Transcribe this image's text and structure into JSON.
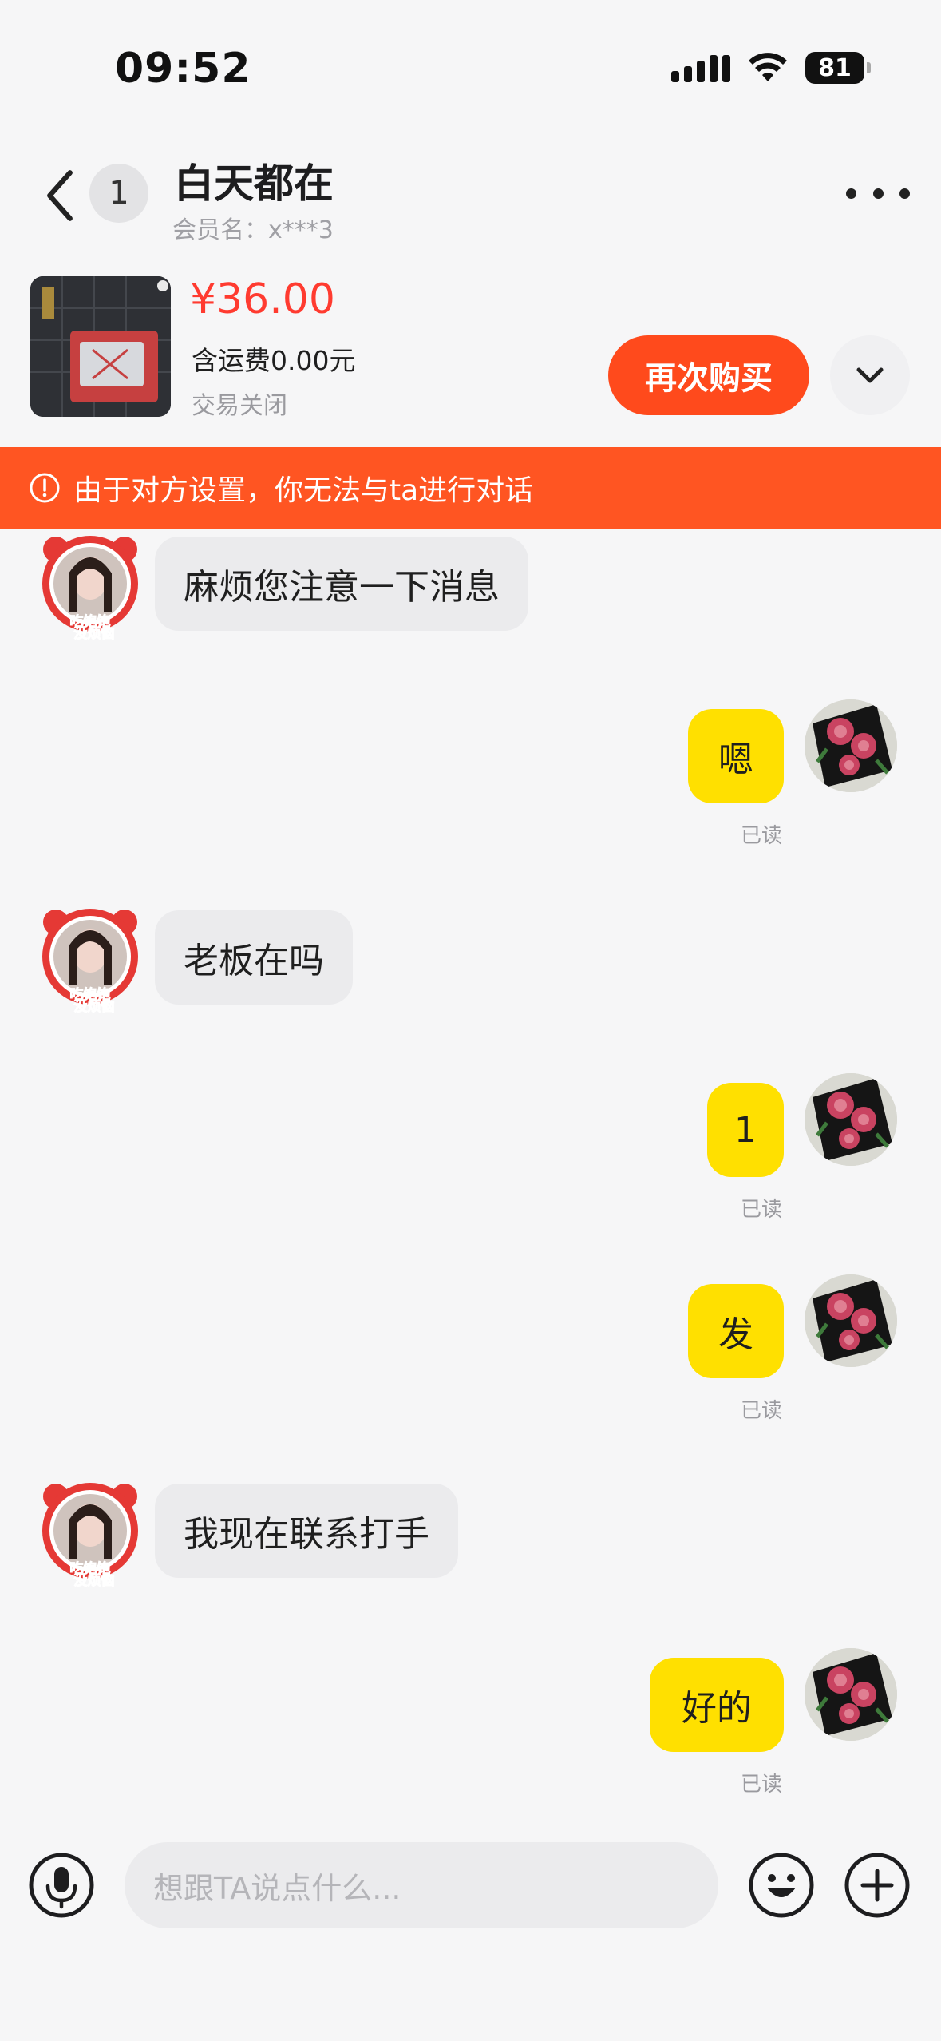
{
  "status_bar": {
    "time": "09:52",
    "battery": "81"
  },
  "header": {
    "unread_count": "1",
    "title": "白天都在",
    "subtitle": "会员名：x***3"
  },
  "order": {
    "price": "¥36.00",
    "shipping": "含运费0.00元",
    "status": "交易关闭",
    "rebuy_label": "再次购买"
  },
  "notice": {
    "text": "由于对方设置，你无法与ta进行对话"
  },
  "messages": [
    {
      "side": "in",
      "text": "麻烦您注意一下消息"
    },
    {
      "side": "out",
      "text": "嗯",
      "status": "已读"
    },
    {
      "side": "in",
      "text": "老板在吗"
    },
    {
      "side": "out",
      "text": "1",
      "status": "已读"
    },
    {
      "side": "out",
      "text": "发",
      "status": "已读"
    },
    {
      "side": "in",
      "text": "我现在联系打手"
    },
    {
      "side": "out",
      "text": "好的",
      "status": "已读"
    }
  ],
  "avatar_sticker_text": [
    "吃饱饱",
    "没烦恼"
  ],
  "input": {
    "placeholder": "想跟TA说点什么..."
  },
  "colors": {
    "accent": "#ff4a1c",
    "price": "#ff3b30",
    "outgoing_bubble": "#ffe000",
    "incoming_bubble": "#ebebed",
    "notice_bg": "#ff5522"
  }
}
